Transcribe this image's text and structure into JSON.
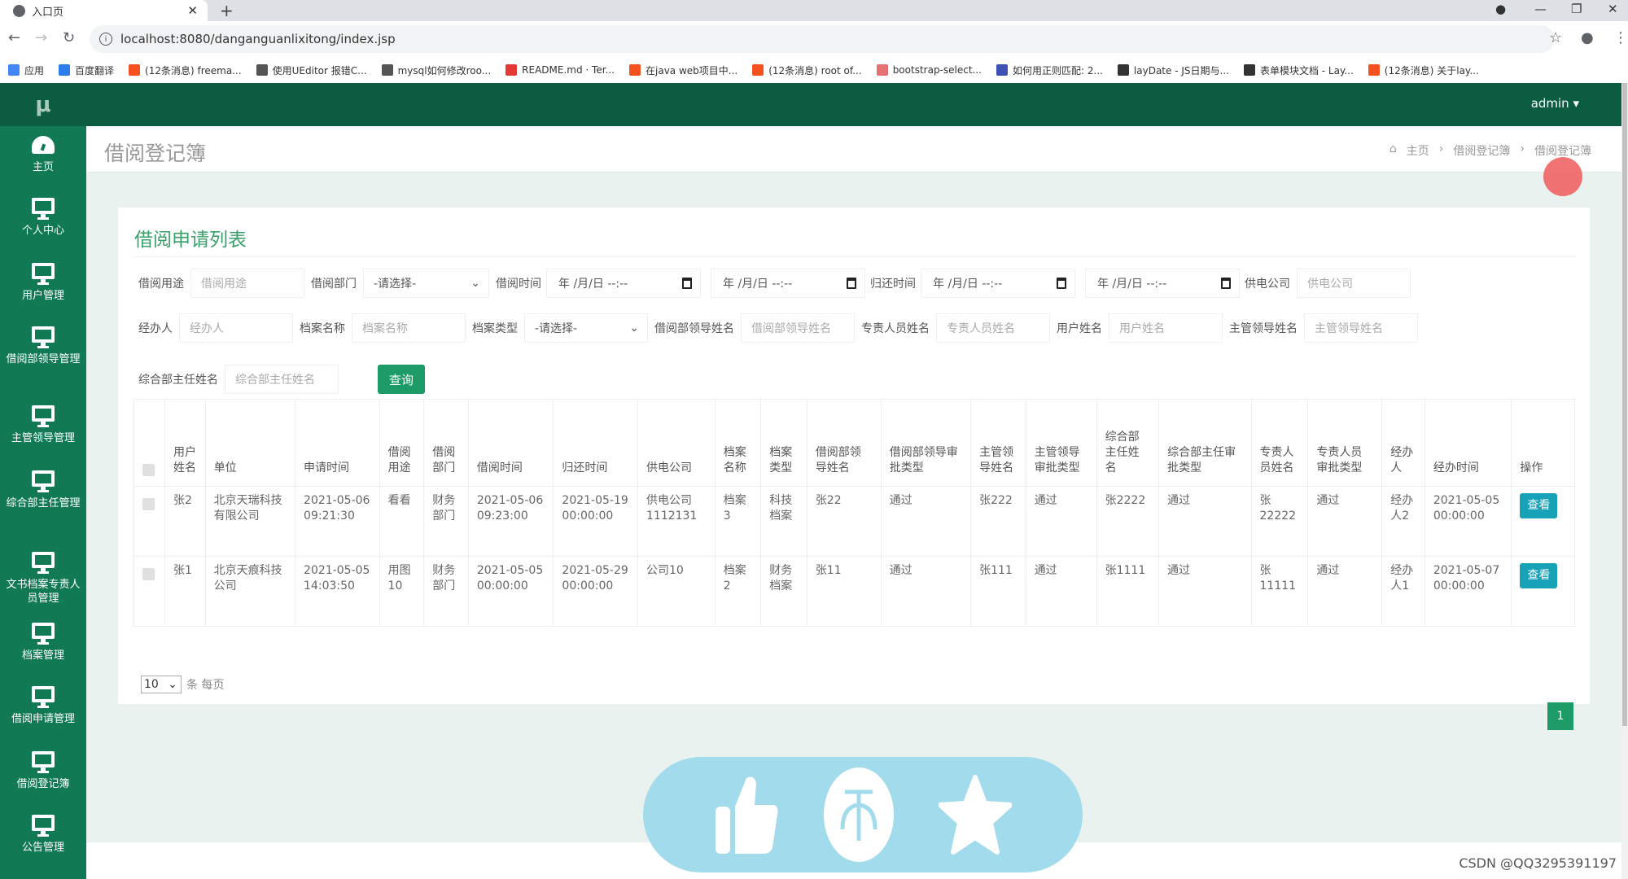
{
  "browser": {
    "tab_title": "入口页",
    "url": "localhost:8080/danganguanlixitong/index.jsp",
    "bookmarks": [
      {
        "label": "应用",
        "color": "#4285f4"
      },
      {
        "label": "百度翻译",
        "color": "#2b7de9"
      },
      {
        "label": "(12条消息) freema...",
        "color": "#f4511e"
      },
      {
        "label": "使用UEditor 报错C...",
        "color": "#555555"
      },
      {
        "label": "mysql如何修改roo...",
        "color": "#555555"
      },
      {
        "label": "README.md · Ter...",
        "color": "#e53935"
      },
      {
        "label": "在java web项目中...",
        "color": "#f4511e"
      },
      {
        "label": "(12条消息) root of...",
        "color": "#f4511e"
      },
      {
        "label": "bootstrap-select...",
        "color": "#e57373"
      },
      {
        "label": "如何用正则匹配: 2...",
        "color": "#3f51b5"
      },
      {
        "label": "layDate - JS日期与...",
        "color": "#333333"
      },
      {
        "label": "表单模块文档 - Lay...",
        "color": "#333333"
      },
      {
        "label": "(12条消息) 关于lay...",
        "color": "#f4511e"
      }
    ]
  },
  "app": {
    "logo": "μ",
    "user": "admin",
    "sidebar": [
      {
        "label": "主页",
        "icon": "dashboard-icon"
      },
      {
        "label": "个人中心",
        "icon": "monitor-icon"
      },
      {
        "label": "用户管理",
        "icon": "monitor-icon"
      },
      {
        "label": "借阅部领导管理",
        "icon": "monitor-icon"
      },
      {
        "label": "主管领导管理",
        "icon": "monitor-icon"
      },
      {
        "label": "综合部主任管理",
        "icon": "monitor-icon"
      },
      {
        "label": "文书档案专责人员管理",
        "icon": "monitor-icon"
      },
      {
        "label": "档案管理",
        "icon": "monitor-icon"
      },
      {
        "label": "借阅申请管理",
        "icon": "monitor-icon"
      },
      {
        "label": "借阅登记簿",
        "icon": "monitor-icon"
      },
      {
        "label": "公告管理",
        "icon": "monitor-icon"
      }
    ],
    "page_title": "借阅登记簿",
    "breadcrumb": [
      "主页",
      "借阅登记簿",
      "借阅登记簿"
    ],
    "card_title": "借阅申请列表"
  },
  "filters": {
    "borrow_purpose": {
      "label": "借阅用途",
      "placeholder": "借阅用途"
    },
    "borrow_dept": {
      "label": "借阅部门",
      "value": "-请选择-"
    },
    "borrow_time": {
      "label": "借阅时间",
      "from": "年 /月/日 --:--",
      "to": "年 /月/日 --:--"
    },
    "return_time": {
      "label": "归还时间",
      "from": "年 /月/日 --:--",
      "to": "年 /月/日 --:--"
    },
    "power_company": {
      "label": "供电公司",
      "placeholder": "供电公司"
    },
    "handler": {
      "label": "经办人",
      "placeholder": "经办人"
    },
    "archive_name": {
      "label": "档案名称",
      "placeholder": "档案名称"
    },
    "archive_type": {
      "label": "档案类型",
      "value": "-请选择-"
    },
    "dept_leader": {
      "label": "借阅部领导姓名",
      "placeholder": "借阅部领导姓名"
    },
    "staff": {
      "label": "专责人员姓名",
      "placeholder": "专责人员姓名"
    },
    "user_name": {
      "label": "用户姓名",
      "placeholder": "用户姓名"
    },
    "supervisor": {
      "label": "主管领导姓名",
      "placeholder": "主管领导姓名"
    },
    "director": {
      "label": "综合部主任姓名",
      "placeholder": "综合部主任姓名"
    },
    "query_button": "查询"
  },
  "table": {
    "headers": [
      "用户姓名",
      "单位",
      "申请时间",
      "借阅用途",
      "借阅部门",
      "借阅时间",
      "归还时间",
      "供电公司",
      "档案名称",
      "档案类型",
      "借阅部领导姓名",
      "借阅部领导审批类型",
      "主管领导姓名",
      "主管领导审批类型",
      "综合部主任姓名",
      "综合部主任审批类型",
      "专责人员姓名",
      "专责人员审批类型",
      "经办人",
      "经办时间",
      "操作"
    ],
    "rows": [
      [
        "张2",
        "北京天瑞科技有限公司",
        "2021-05-06 09:21:30",
        "看看",
        "财务部门",
        "2021-05-06 09:23:00",
        "2021-05-19 00:00:00",
        "供电公司1112131",
        "档案3",
        "科技档案",
        "张22",
        "通过",
        "张222",
        "通过",
        "张2222",
        "通过",
        "张22222",
        "通过",
        "经办人2",
        "2021-05-05 00:00:00",
        "查看"
      ],
      [
        "张1",
        "北京天痕科技公司",
        "2021-05-05 14:03:50",
        "用图10",
        "财务部门",
        "2021-05-05 00:00:00",
        "2021-05-29 00:00:00",
        "公司10",
        "档案2",
        "财务档案",
        "张11",
        "通过",
        "张111",
        "通过",
        "张1111",
        "通过",
        "张11111",
        "通过",
        "经办人1",
        "2021-05-07 00:00:00",
        "查看"
      ]
    ]
  },
  "pagination": {
    "page_size": "10",
    "page_size_suffix": "条 每页",
    "current_page": "1"
  },
  "watermark": "CSDN @QQ3295391197"
}
